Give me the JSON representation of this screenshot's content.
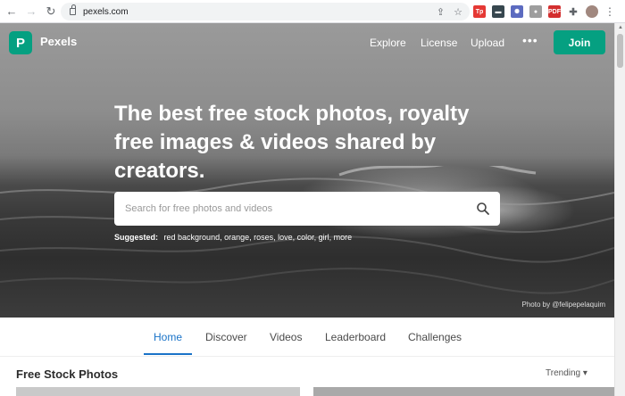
{
  "browser": {
    "url": "pexels.com",
    "back_glyph": "←",
    "forward_glyph": "→",
    "reload_glyph": "↻",
    "share_glyph": "⇪",
    "star_glyph": "☆",
    "menu_glyph": "⋮",
    "extensions": [
      {
        "icon": "tp-extension-icon",
        "label": "Tp",
        "color": "#e53935"
      },
      {
        "icon": "dark-extension-icon",
        "label": "▬",
        "color": "#37474f"
      },
      {
        "icon": "gear-extension-icon",
        "label": "✺",
        "color": "#5c6bc0"
      },
      {
        "icon": "shield-extension-icon",
        "label": "●",
        "color": "#9e9e9e"
      },
      {
        "icon": "red-extension-icon",
        "label": "PDF",
        "color": "#d32f2f"
      },
      {
        "icon": "puzzle-icon",
        "label": "✚",
        "color": "#5f6368"
      },
      {
        "icon": "profile-avatar-icon",
        "label": "",
        "color": "#a1887f"
      }
    ]
  },
  "header": {
    "logo_letter": "P",
    "brand": "Pexels",
    "nav": [
      "Explore",
      "License",
      "Upload"
    ],
    "more": "•••",
    "join": "Join"
  },
  "hero": {
    "headline": "The best free stock photos, royalty free images & videos shared by creators.",
    "search_placeholder": "Search for free photos and videos",
    "suggested_label": "Suggested:",
    "suggested_items": "red background, orange, roses, love, color, girl, more",
    "credit": "Photo by @felipepelaquim"
  },
  "tabs": [
    "Home",
    "Discover",
    "Videos",
    "Leaderboard",
    "Challenges"
  ],
  "section": {
    "title": "Free Stock Photos",
    "sort": "Trending ▾"
  },
  "colors": {
    "brand_green": "#05a081",
    "tab_active": "#1a73c8"
  }
}
